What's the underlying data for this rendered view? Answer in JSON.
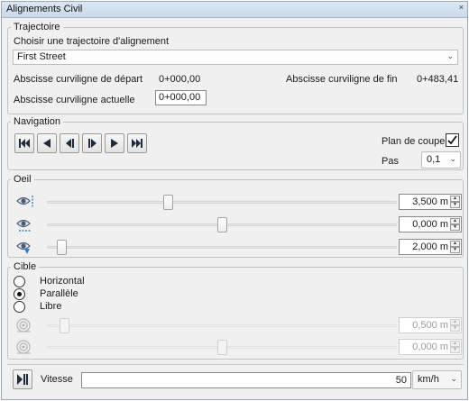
{
  "window": {
    "title": "Alignements Civil",
    "close_glyph": "×"
  },
  "trajectoire": {
    "legend": "Trajectoire",
    "choose_label": "Choisir une trajectoire d'alignement",
    "selected_alignment": "First Street",
    "start_label": "Abscisse curviligne de départ",
    "start_value": "0+000,00",
    "end_label": "Abscisse curviligne de fin",
    "end_value": "0+483,41",
    "current_label": "Abscisse curviligne actuelle",
    "current_value": "0+000,00"
  },
  "navigation": {
    "legend": "Navigation",
    "buttons": [
      "go-to-start",
      "step-back",
      "frame-back",
      "frame-forward",
      "step-forward",
      "go-to-end"
    ],
    "section_label": "Plan de coupe",
    "section_checked": true,
    "step_label": "Pas",
    "step_value": "0,1"
  },
  "oeil": {
    "legend": "Oeil",
    "rows": [
      {
        "icon": "eye-height-icon",
        "value": "3,500 m",
        "level": 0.345
      },
      {
        "icon": "eye-offset-icon",
        "value": "0,000 m",
        "level": 0.5
      },
      {
        "icon": "eye-lower-icon",
        "value": "2,000 m",
        "level": 0.04
      }
    ]
  },
  "cible": {
    "legend": "Cible",
    "options": [
      {
        "label": "Horizontal",
        "selected": false
      },
      {
        "label": "Parallèle",
        "selected": true
      },
      {
        "label": "Libre",
        "selected": false
      }
    ],
    "rows": [
      {
        "icon": "target-distance-icon",
        "value": "0,500 m",
        "level": 0.05
      },
      {
        "icon": "target-offset-icon",
        "value": "0,000 m",
        "level": 0.5
      }
    ]
  },
  "footer": {
    "speed_label": "Vitesse",
    "speed_value": "50",
    "speed_unit": "km/h"
  }
}
